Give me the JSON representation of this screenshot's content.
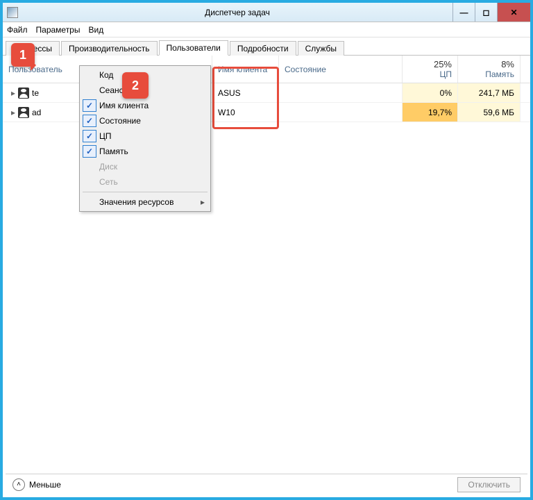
{
  "window": {
    "title": "Диспетчер задач",
    "min": "—",
    "max": "◻",
    "close": "✕"
  },
  "menu": {
    "file": "Файл",
    "options": "Параметры",
    "view": "Вид"
  },
  "tabs": {
    "processes": "Процессы",
    "performance": "Производительность",
    "users": "Пользователи",
    "details": "Подробности",
    "services": "Службы"
  },
  "columns": {
    "user": "Пользователь",
    "client": "Имя клиента",
    "state": "Состояние",
    "cpu_pct": "25%",
    "cpu_label": "ЦП",
    "mem_pct": "8%",
    "mem_label": "Память"
  },
  "rows": [
    {
      "user": "te",
      "client": "ASUS",
      "state": "",
      "cpu": "0%",
      "mem": "241,7 МБ",
      "cpu_heat": "heat-low",
      "mem_heat": "heat-low"
    },
    {
      "user": "ad",
      "client": "W10",
      "state": "",
      "cpu": "19,7%",
      "mem": "59,6 МБ",
      "cpu_heat": "heat-med",
      "mem_heat": "heat-low"
    }
  ],
  "context": {
    "code": "Код",
    "session": "Сеанс",
    "client": "Имя клиента",
    "state": "Состояние",
    "cpu": "ЦП",
    "memory": "Память",
    "disk": "Диск",
    "network": "Сеть",
    "values": "Значения ресурсов"
  },
  "footer": {
    "less": "Меньше",
    "disconnect": "Отключить"
  },
  "callouts": {
    "one": "1",
    "two": "2"
  }
}
